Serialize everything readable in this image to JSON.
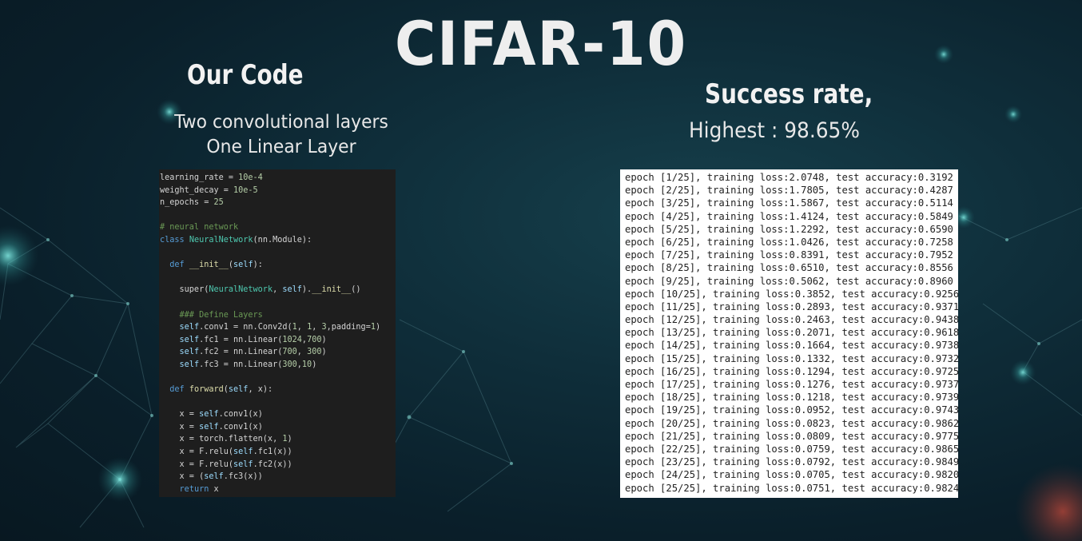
{
  "title": "CIFAR-10",
  "left": {
    "heading": "Our Code",
    "subtitle_line1": "Two convolutional layers",
    "subtitle_line2": "One Linear Layer",
    "code_lines": [
      "learning_rate = 10e-4",
      "weight_decay = 10e-5",
      "n_epochs = 25",
      "",
      "# neural network",
      "class NeuralNetwork(nn.Module):",
      "",
      "  def __init__(self):",
      "",
      "    super(NeuralNetwork, self).__init__()",
      "",
      "    ### Define Layers",
      "    self.conv1 = nn.Conv2d(1, 1, 3,padding=1)",
      "    self.fc1 = nn.Linear(1024,700)",
      "    self.fc2 = nn.Linear(700, 300)",
      "    self.fc3 = nn.Linear(300,10)",
      "",
      "  def forward(self, x):",
      "",
      "    x = self.conv1(x)",
      "    x = self.conv1(x)",
      "    x = torch.flatten(x, 1)",
      "    x = F.relu(self.fc1(x))",
      "    x = F.relu(self.fc2(x))",
      "    x = (self.fc3(x))",
      "    return x"
    ]
  },
  "right": {
    "heading": "Success rate,",
    "highest": "Highest : 98.65%",
    "log_lines": [
      "epoch [1/25], training loss:2.0748, test accuracy:0.3192",
      "epoch [2/25], training loss:1.7805, test accuracy:0.4287",
      "epoch [3/25], training loss:1.5867, test accuracy:0.5114",
      "epoch [4/25], training loss:1.4124, test accuracy:0.5849",
      "epoch [5/25], training loss:1.2292, test accuracy:0.6590",
      "epoch [6/25], training loss:1.0426, test accuracy:0.7258",
      "epoch [7/25], training loss:0.8391, test accuracy:0.7952",
      "epoch [8/25], training loss:0.6510, test accuracy:0.8556",
      "epoch [9/25], training loss:0.5062, test accuracy:0.8960",
      "epoch [10/25], training loss:0.3852, test accuracy:0.9256",
      "epoch [11/25], training loss:0.2893, test accuracy:0.9371",
      "epoch [12/25], training loss:0.2463, test accuracy:0.9438",
      "epoch [13/25], training loss:0.2071, test accuracy:0.9618",
      "epoch [14/25], training loss:0.1664, test accuracy:0.9738",
      "epoch [15/25], training loss:0.1332, test accuracy:0.9732",
      "epoch [16/25], training loss:0.1294, test accuracy:0.9725",
      "epoch [17/25], training loss:0.1276, test accuracy:0.9737",
      "epoch [18/25], training loss:0.1218, test accuracy:0.9739",
      "epoch [19/25], training loss:0.0952, test accuracy:0.9743",
      "epoch [20/25], training loss:0.0823, test accuracy:0.9862",
      "epoch [21/25], training loss:0.0809, test accuracy:0.9775",
      "epoch [22/25], training loss:0.0759, test accuracy:0.9865",
      "epoch [23/25], training loss:0.0792, test accuracy:0.9849",
      "epoch [24/25], training loss:0.0705, test accuracy:0.9820",
      "epoch [25/25], training loss:0.0751, test accuracy:0.9824"
    ]
  },
  "colors": {
    "code_keyword": "#569cd6",
    "code_comment": "#6a9955",
    "code_number": "#b5cea8",
    "code_function": "#dcdcaa",
    "code_class": "#4ec9b0",
    "code_self": "#9cdcfe"
  }
}
